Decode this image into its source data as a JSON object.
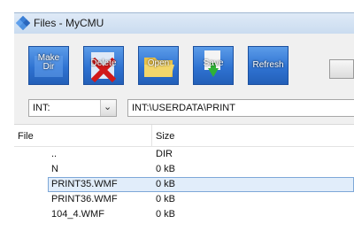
{
  "window": {
    "title": "Files - MyCMU"
  },
  "toolbar": {
    "make_dir": "Make Dir",
    "delete": "Delete",
    "open": "Open",
    "save": "Save",
    "refresh": "Refresh"
  },
  "drive": {
    "selected": "INT:"
  },
  "path": {
    "value": "INT:\\USERDATA\\PRINT"
  },
  "columns": {
    "file": "File",
    "size": "Size"
  },
  "files": [
    {
      "name": "..",
      "size": "DIR"
    },
    {
      "name": "N",
      "size": "0 kB"
    },
    {
      "name": "PRINT35.WMF",
      "size": "0 kB",
      "selected": true
    },
    {
      "name": "PRINT36.WMF",
      "size": "0 kB"
    },
    {
      "name": "104_4.WMF",
      "size": "0 kB"
    }
  ]
}
